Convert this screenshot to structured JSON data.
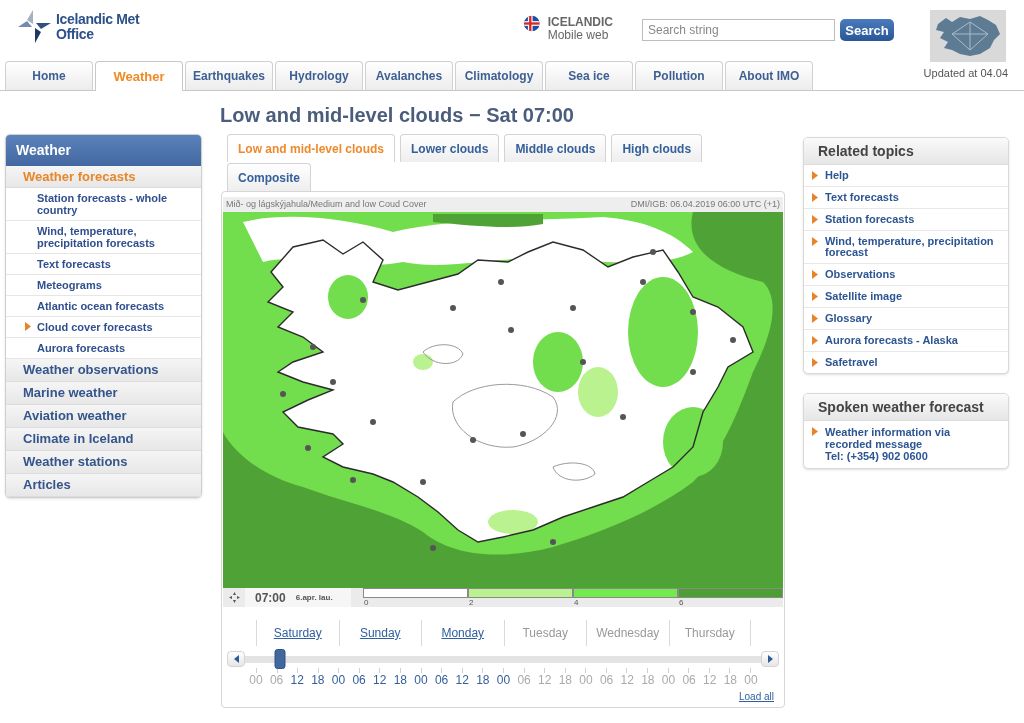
{
  "header": {
    "logo_text": "Icelandic Met Office",
    "language": {
      "label": "ICELANDIC",
      "sublabel": "Mobile web"
    },
    "search": {
      "placeholder": "Search string",
      "button": "Search"
    },
    "updated": "Updated at 04.04"
  },
  "nav_tabs": [
    {
      "label": "Home",
      "selected": false
    },
    {
      "label": "Weather",
      "selected": true
    },
    {
      "label": "Earthquakes",
      "selected": false
    },
    {
      "label": "Hydrology",
      "selected": false
    },
    {
      "label": "Avalanches",
      "selected": false
    },
    {
      "label": "Climatology",
      "selected": false
    },
    {
      "label": "Sea ice",
      "selected": false
    },
    {
      "label": "Pollution",
      "selected": false
    },
    {
      "label": "About IMO",
      "selected": false
    }
  ],
  "page_title": "Low and mid-level clouds − Sat 07:00",
  "sidebar": {
    "title": "Weather",
    "items": [
      {
        "label": "Weather forecasts",
        "selected": true,
        "children": [
          {
            "label": "Station forecasts - whole country",
            "selected": false
          },
          {
            "label": "Wind, temperature, precipitation forecasts",
            "selected": false
          },
          {
            "label": "Text forecasts",
            "selected": false
          },
          {
            "label": "Meteograms",
            "selected": false
          },
          {
            "label": "Atlantic ocean forecasts",
            "selected": false
          },
          {
            "label": "Cloud cover forecasts",
            "selected": true
          },
          {
            "label": "Aurora forecasts",
            "selected": false
          }
        ]
      },
      {
        "label": "Weather observations",
        "selected": false
      },
      {
        "label": "Marine weather",
        "selected": false
      },
      {
        "label": "Aviation weather",
        "selected": false
      },
      {
        "label": "Climate in Iceland",
        "selected": false
      },
      {
        "label": "Weather stations",
        "selected": false
      },
      {
        "label": "Articles",
        "selected": false
      }
    ]
  },
  "cloud_tabs": [
    {
      "label": "Low and mid-level clouds",
      "selected": true
    },
    {
      "label": "Lower clouds",
      "selected": false
    },
    {
      "label": "Middle clouds",
      "selected": false
    },
    {
      "label": "High clouds",
      "selected": false
    },
    {
      "label": "Composite",
      "selected": false
    }
  ],
  "map_panel": {
    "caption_left": "Mið- og lágskýjahula/Medium and low Coud Cover",
    "caption_right": "DMI/IGB: 06.04.2019 06:00 UTC (+1)",
    "time": "07:00",
    "date": "6.apr. lau.",
    "legend": [
      {
        "tick": "0",
        "color": "#ffffff"
      },
      {
        "tick": "2",
        "color": "#b9f28e"
      },
      {
        "tick": "4",
        "color": "#72ec4c"
      },
      {
        "tick": "6",
        "color": "#4c9f32"
      }
    ]
  },
  "timeline": {
    "days": [
      {
        "label": "Saturday",
        "available": true
      },
      {
        "label": "Sunday",
        "available": true
      },
      {
        "label": "Monday",
        "available": true
      },
      {
        "label": "Tuesday",
        "available": false
      },
      {
        "label": "Wednesday",
        "available": false
      },
      {
        "label": "Thursday",
        "available": false
      }
    ],
    "level": 0.049,
    "hours": [
      {
        "label": "00",
        "available": false
      },
      {
        "label": "06",
        "available": false
      },
      {
        "label": "12",
        "available": true
      },
      {
        "label": "18",
        "available": true
      },
      {
        "label": "00",
        "available": true
      },
      {
        "label": "06",
        "available": true
      },
      {
        "label": "12",
        "available": true
      },
      {
        "label": "18",
        "available": true
      },
      {
        "label": "00",
        "available": true
      },
      {
        "label": "06",
        "available": true
      },
      {
        "label": "12",
        "available": true
      },
      {
        "label": "18",
        "available": true
      },
      {
        "label": "00",
        "available": true
      },
      {
        "label": "06",
        "available": false
      },
      {
        "label": "12",
        "available": false
      },
      {
        "label": "18",
        "available": false
      },
      {
        "label": "00",
        "available": false
      },
      {
        "label": "06",
        "available": false
      },
      {
        "label": "12",
        "available": false
      },
      {
        "label": "18",
        "available": false
      },
      {
        "label": "00",
        "available": false
      },
      {
        "label": "06",
        "available": false
      },
      {
        "label": "12",
        "available": false
      },
      {
        "label": "18",
        "available": false
      },
      {
        "label": "00",
        "available": false
      }
    ],
    "load_all": "Load all"
  },
  "related_topics": {
    "title": "Related topics",
    "items": [
      "Help",
      "Text forecasts",
      "Station forecasts",
      "Wind, temperature, precipitation forecast",
      "Observations",
      "Satellite image",
      "Glossary",
      "Aurora forecasts - Alaska",
      "Safetravel"
    ]
  },
  "spoken_forecast": {
    "title": "Spoken weather forecast",
    "items": [
      {
        "label": "Weather information via recorded message",
        "phone": "Tel: (+354) 902 0600"
      }
    ]
  }
}
